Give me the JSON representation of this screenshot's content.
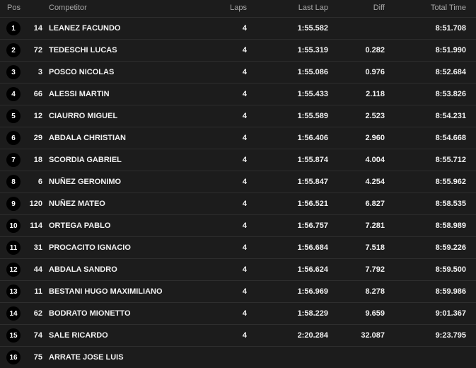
{
  "columns": {
    "pos": "Pos",
    "competitor": "Competitor",
    "laps": "Laps",
    "last_lap": "Last Lap",
    "diff": "Diff",
    "total_time": "Total Time"
  },
  "rows": [
    {
      "pos": "1",
      "number": "14",
      "name": "LEANEZ FACUNDO",
      "laps": "4",
      "last_lap": "1:55.582",
      "diff": "",
      "total": "8:51.708"
    },
    {
      "pos": "2",
      "number": "72",
      "name": "TEDESCHI LUCAS",
      "laps": "4",
      "last_lap": "1:55.319",
      "diff": "0.282",
      "total": "8:51.990"
    },
    {
      "pos": "3",
      "number": "3",
      "name": "POSCO NICOLAS",
      "laps": "4",
      "last_lap": "1:55.086",
      "diff": "0.976",
      "total": "8:52.684"
    },
    {
      "pos": "4",
      "number": "66",
      "name": "ALESSI MARTIN",
      "laps": "4",
      "last_lap": "1:55.433",
      "diff": "2.118",
      "total": "8:53.826"
    },
    {
      "pos": "5",
      "number": "12",
      "name": "CIAURRO MIGUEL",
      "laps": "4",
      "last_lap": "1:55.589",
      "diff": "2.523",
      "total": "8:54.231"
    },
    {
      "pos": "6",
      "number": "29",
      "name": "ABDALA CHRISTIAN",
      "laps": "4",
      "last_lap": "1:56.406",
      "diff": "2.960",
      "total": "8:54.668"
    },
    {
      "pos": "7",
      "number": "18",
      "name": "SCORDIA GABRIEL",
      "laps": "4",
      "last_lap": "1:55.874",
      "diff": "4.004",
      "total": "8:55.712"
    },
    {
      "pos": "8",
      "number": "6",
      "name": "NUÑEZ GERONIMO",
      "laps": "4",
      "last_lap": "1:55.847",
      "diff": "4.254",
      "total": "8:55.962"
    },
    {
      "pos": "9",
      "number": "120",
      "name": "NUÑEZ MATEO",
      "laps": "4",
      "last_lap": "1:56.521",
      "diff": "6.827",
      "total": "8:58.535"
    },
    {
      "pos": "10",
      "number": "114",
      "name": "ORTEGA PABLO",
      "laps": "4",
      "last_lap": "1:56.757",
      "diff": "7.281",
      "total": "8:58.989"
    },
    {
      "pos": "11",
      "number": "31",
      "name": "PROCACITO IGNACIO",
      "laps": "4",
      "last_lap": "1:56.684",
      "diff": "7.518",
      "total": "8:59.226"
    },
    {
      "pos": "12",
      "number": "44",
      "name": "ABDALA SANDRO",
      "laps": "4",
      "last_lap": "1:56.624",
      "diff": "7.792",
      "total": "8:59.500"
    },
    {
      "pos": "13",
      "number": "11",
      "name": "BESTANI HUGO MAXIMILIANO",
      "laps": "4",
      "last_lap": "1:56.969",
      "diff": "8.278",
      "total": "8:59.986"
    },
    {
      "pos": "14",
      "number": "62",
      "name": "BODRATO MIONETTO",
      "laps": "4",
      "last_lap": "1:58.229",
      "diff": "9.659",
      "total": "9:01.367"
    },
    {
      "pos": "15",
      "number": "74",
      "name": "SALE RICARDO",
      "laps": "4",
      "last_lap": "2:20.284",
      "diff": "32.087",
      "total": "9:23.795"
    },
    {
      "pos": "16",
      "number": "75",
      "name": "ARRATE JOSE LUIS",
      "laps": "",
      "last_lap": "",
      "diff": "",
      "total": ""
    }
  ]
}
